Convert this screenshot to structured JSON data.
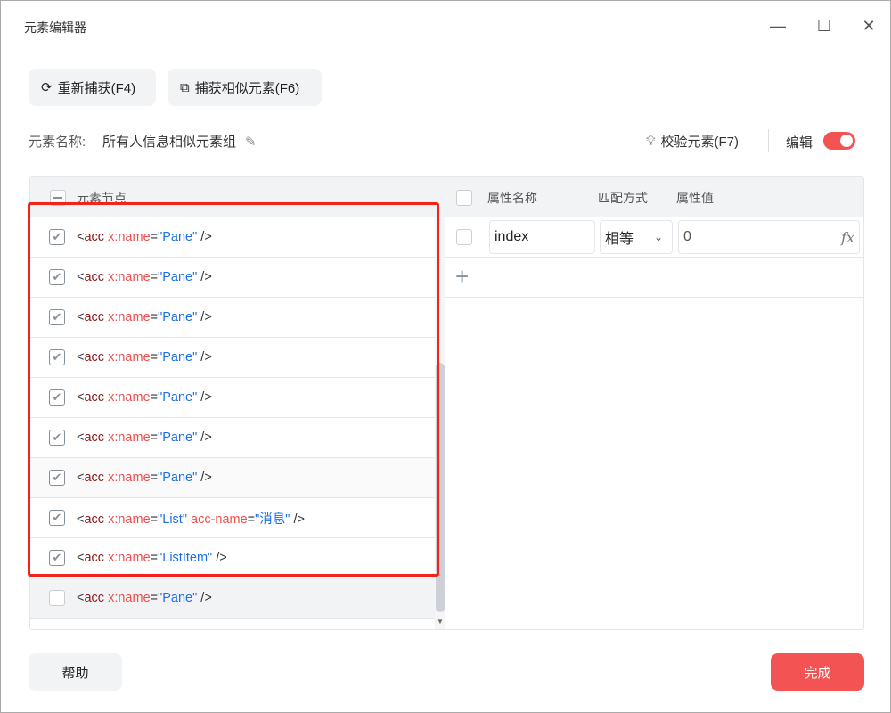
{
  "window": {
    "title": "元素编辑器"
  },
  "toolbar": {
    "recapture": "重新捕获(F4)",
    "capture_similar": "捕获相似元素(F6)"
  },
  "element_name": {
    "label": "元素名称:",
    "value": "所有人信息相似元素组"
  },
  "verify_label": "校验元素(F7)",
  "edit_label": "编辑",
  "edit_enabled": true,
  "left_header": "元素节点",
  "nodes": [
    {
      "checked": true,
      "tag": "acc",
      "attrs": [
        {
          "name": "x:name",
          "value": "Pane"
        }
      ]
    },
    {
      "checked": true,
      "tag": "acc",
      "attrs": [
        {
          "name": "x:name",
          "value": "Pane"
        }
      ]
    },
    {
      "checked": true,
      "tag": "acc",
      "attrs": [
        {
          "name": "x:name",
          "value": "Pane"
        }
      ]
    },
    {
      "checked": true,
      "tag": "acc",
      "attrs": [
        {
          "name": "x:name",
          "value": "Pane"
        }
      ]
    },
    {
      "checked": true,
      "tag": "acc",
      "attrs": [
        {
          "name": "x:name",
          "value": "Pane"
        }
      ]
    },
    {
      "checked": true,
      "tag": "acc",
      "attrs": [
        {
          "name": "x:name",
          "value": "Pane"
        }
      ]
    },
    {
      "checked": true,
      "tag": "acc",
      "attrs": [
        {
          "name": "x:name",
          "value": "Pane"
        }
      ]
    },
    {
      "checked": true,
      "tag": "acc",
      "attrs": [
        {
          "name": "x:name",
          "value": "List"
        },
        {
          "name": "acc-name",
          "value": "消息"
        }
      ]
    },
    {
      "checked": true,
      "tag": "acc",
      "attrs": [
        {
          "name": "x:name",
          "value": "ListItem"
        }
      ]
    },
    {
      "checked": false,
      "tag": "acc",
      "attrs": [
        {
          "name": "x:name",
          "value": "Pane"
        }
      ]
    }
  ],
  "attr_table": {
    "headers": [
      "属性名称",
      "匹配方式",
      "属性值"
    ],
    "rows": [
      {
        "name": "index",
        "match": "相等",
        "value": "0"
      }
    ]
  },
  "footer": {
    "help": "帮助",
    "done": "完成"
  },
  "colors": {
    "accent": "#f45353",
    "highlight_box": "#f5221b"
  }
}
